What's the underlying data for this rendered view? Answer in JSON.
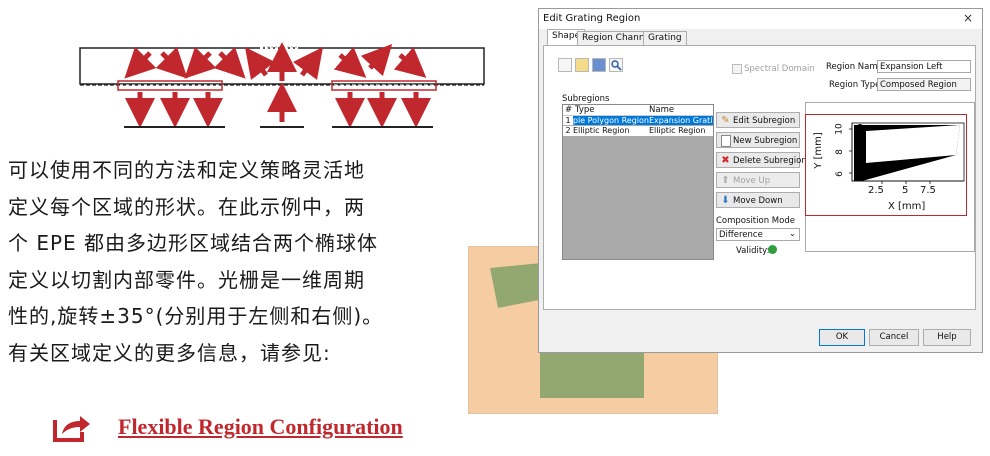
{
  "paragraph": {
    "lines": [
      "可以使用不同的方法和定义策略灵活地",
      "定义每个区域的形状。在此示例中，两",
      "个 EPE 都由多边形区域结合两个椭球体",
      "定义以切割内部零件。光栅是一维周期",
      "性的,旋转±35°(分别用于左侧和右侧)。",
      "有关区域定义的更多信息，请参见:"
    ]
  },
  "link": {
    "text": "Flexible Region Configuration",
    "icon": "share-arrow-icon",
    "color": "#c0282e"
  },
  "dialog": {
    "title": "Edit Grating Region",
    "close": "×",
    "tabs": [
      "Shape",
      "Region Channels",
      "Grating"
    ],
    "active_tab": "Shape",
    "spectral_domain_label": "Spectral Domain",
    "region_name_label": "Region Name",
    "region_name_value": "Expansion Left",
    "region_type_label": "Region Type",
    "region_type_value": "Composed Region",
    "subregions_label": "Subregions",
    "table": {
      "columns": [
        "#",
        "Type",
        "Name"
      ],
      "rows": [
        {
          "index": "1",
          "type": "Simple Polygon Region",
          "name": "Expansion Grating"
        },
        {
          "index": "2",
          "type": "Elliptic Region",
          "name": "Elliptic Region"
        }
      ]
    },
    "buttons": {
      "edit": "Edit Subregion",
      "new": "New Subregion",
      "delete": "Delete Subregion",
      "move_up": "Move Up",
      "move_down": "Move Down"
    },
    "composition_mode_label": "Composition Mode",
    "composition_mode_value": "Difference",
    "validity_label": "Validity:",
    "preview_plot": {
      "ylabel": "Y [mm]",
      "xlabel": "X [mm]",
      "yticks": [
        "10",
        "8",
        "6"
      ],
      "xticks": [
        "2.5",
        "5",
        "7.5"
      ]
    },
    "footer": {
      "ok": "OK",
      "cancel": "Cancel",
      "help": "Help"
    }
  },
  "colors": {
    "accent_red": "#c0282e",
    "region_green": "#93a871",
    "region_peach": "#f6cda3",
    "arrow_red": "#c0282e"
  }
}
